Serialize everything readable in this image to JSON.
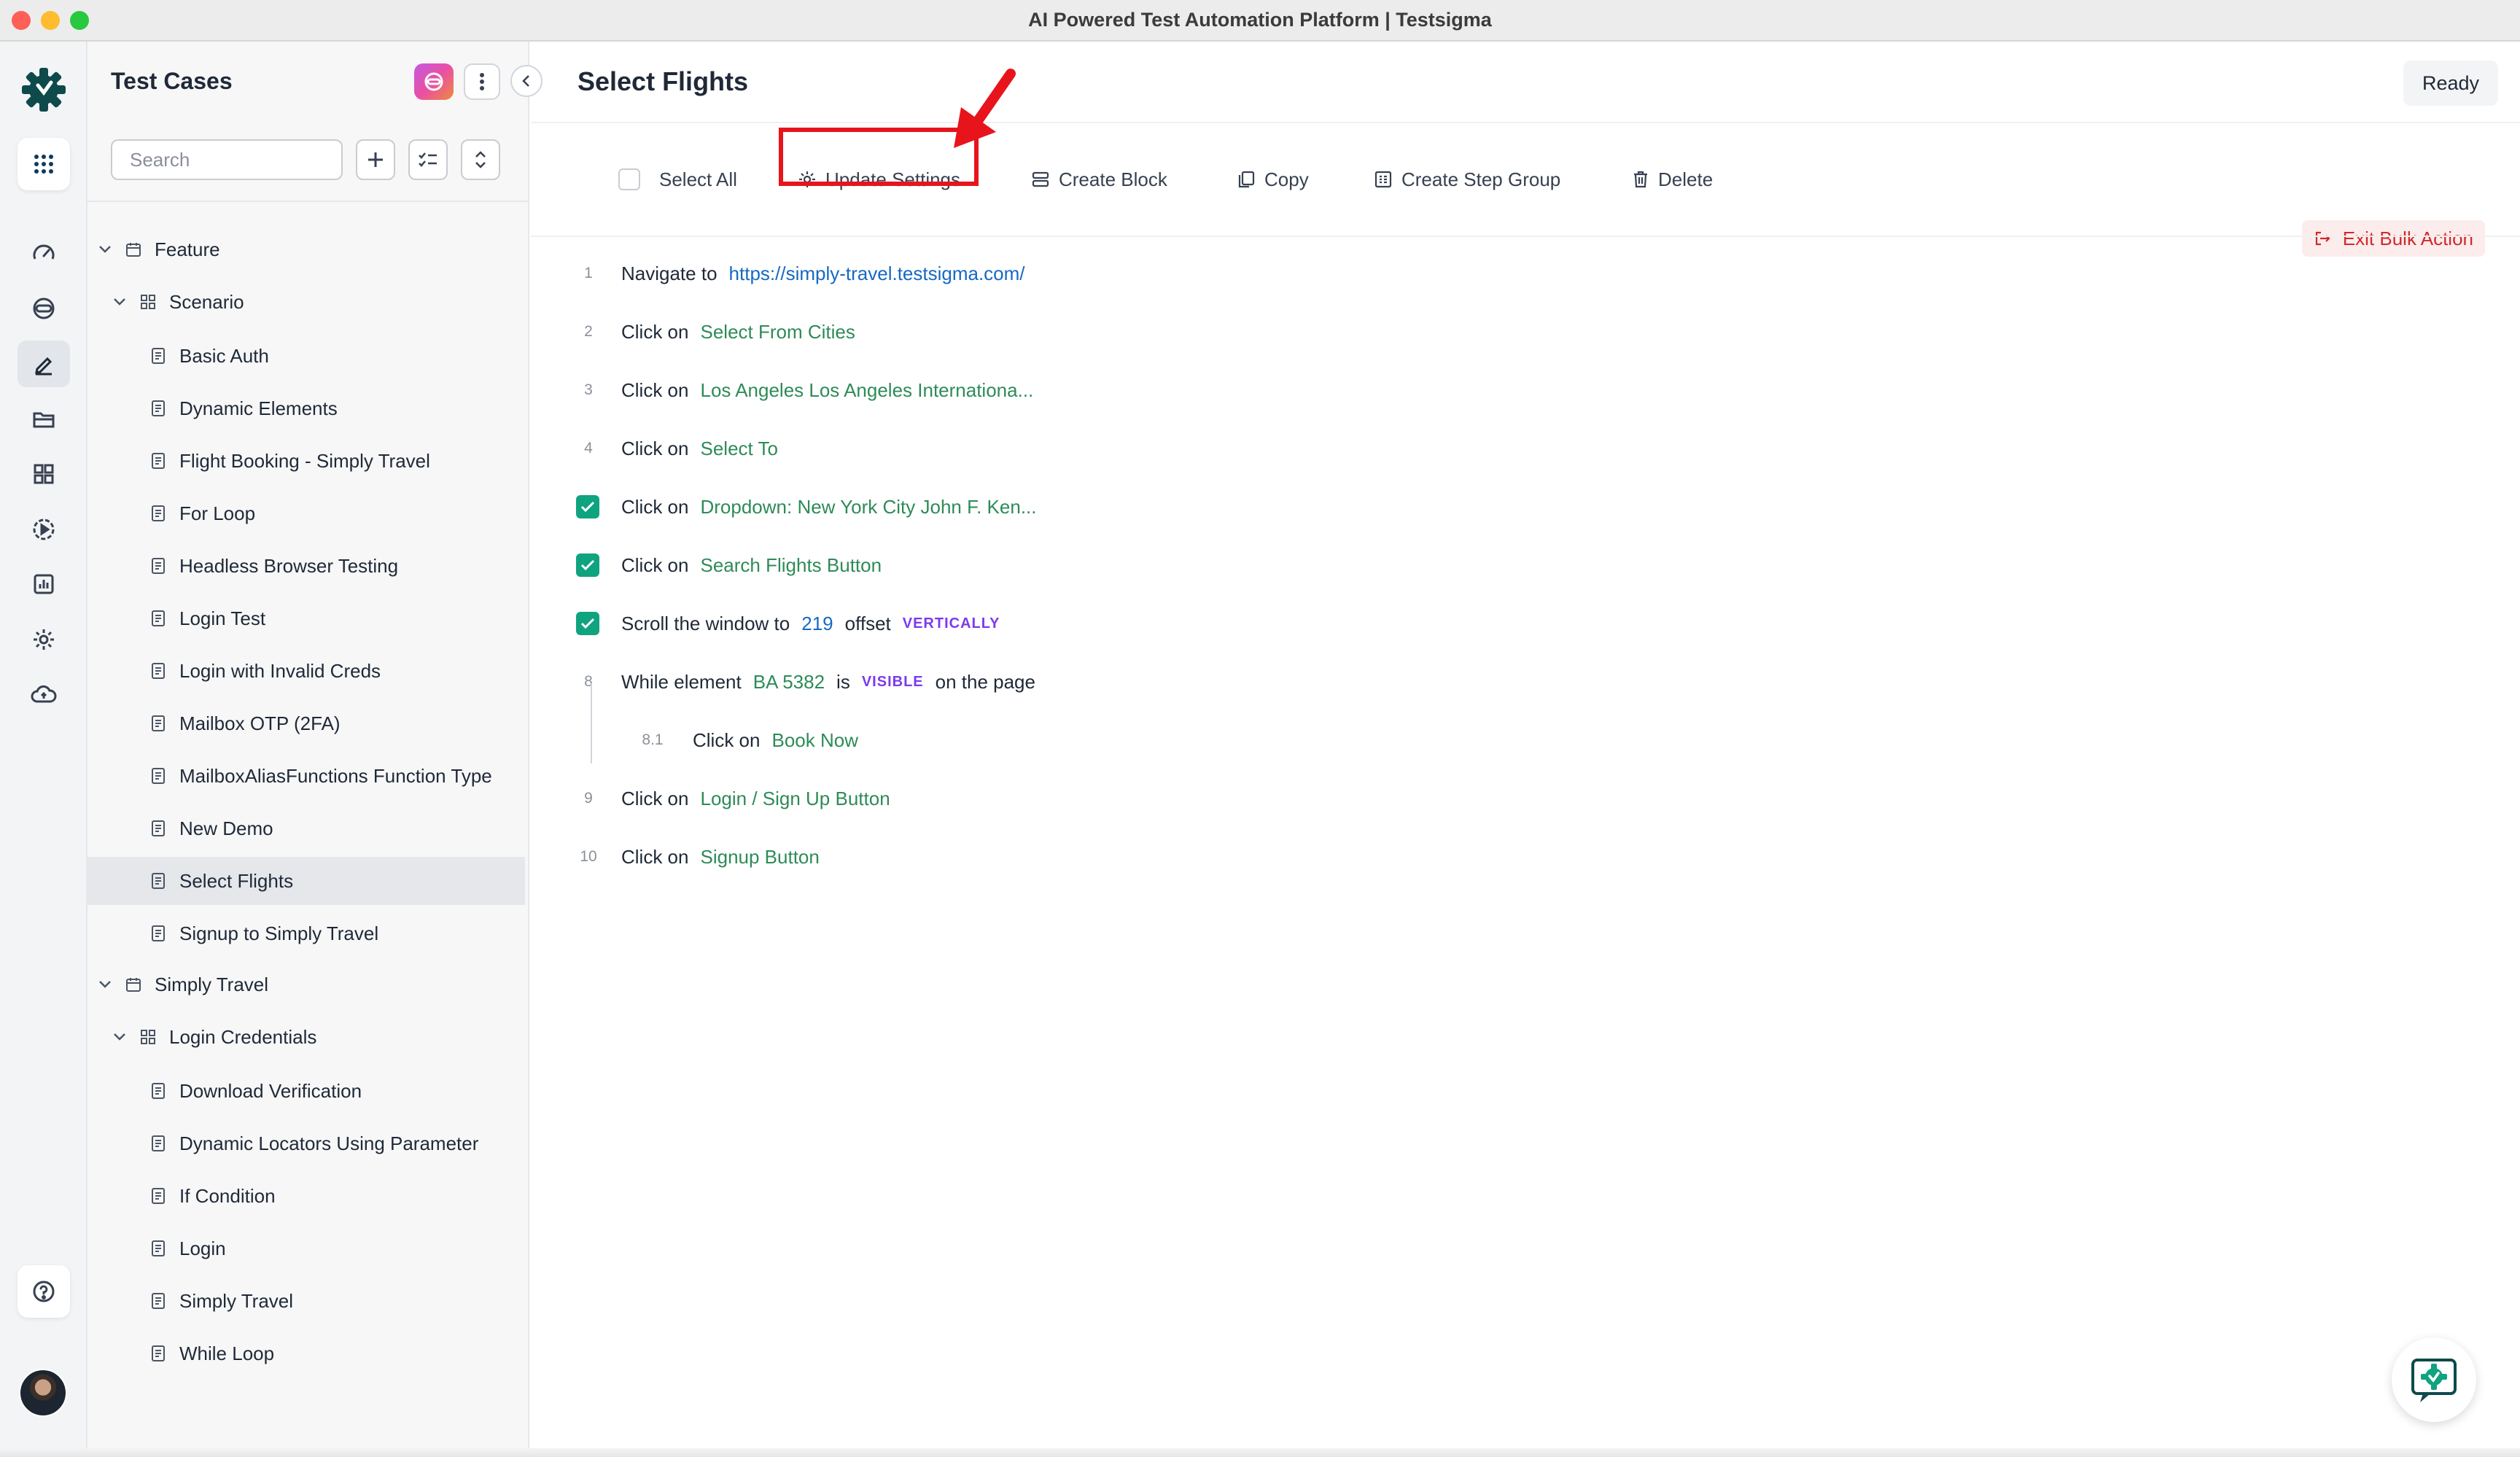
{
  "window": {
    "title": "AI Powered Test Automation Platform | Testsigma"
  },
  "rail": {
    "icons": [
      "apps-icon",
      "dashboard-icon",
      "ai-agent-icon",
      "edit-icon",
      "folder-icon",
      "widgets-icon",
      "run-icon",
      "reports-icon",
      "settings-icon",
      "cloud-icon"
    ],
    "active": "edit-icon"
  },
  "panel": {
    "title": "Test Cases",
    "search_placeholder": "Search",
    "tree": [
      {
        "label": "Feature",
        "type": "feature",
        "level": 0
      },
      {
        "label": "Scenario",
        "type": "scenario",
        "level": 1
      },
      {
        "label": "Basic Auth",
        "type": "case",
        "level": 2
      },
      {
        "label": "Dynamic Elements",
        "type": "case",
        "level": 2
      },
      {
        "label": "Flight Booking - Simply Travel",
        "type": "case",
        "level": 2
      },
      {
        "label": "For Loop",
        "type": "case",
        "level": 2
      },
      {
        "label": "Headless Browser Testing",
        "type": "case",
        "level": 2
      },
      {
        "label": "Login Test",
        "type": "case",
        "level": 2
      },
      {
        "label": "Login with Invalid Creds",
        "type": "case",
        "level": 2
      },
      {
        "label": "Mailbox OTP (2FA)",
        "type": "case",
        "level": 2
      },
      {
        "label": "MailboxAliasFunctions Function Type",
        "type": "case",
        "level": 2
      },
      {
        "label": "New Demo",
        "type": "case",
        "level": 2
      },
      {
        "label": "Select Flights",
        "type": "case",
        "level": 2,
        "selected": true
      },
      {
        "label": "Signup to Simply Travel",
        "type": "case",
        "level": 2
      },
      {
        "label": "Simply Travel",
        "type": "feature",
        "level": 0
      },
      {
        "label": "Login Credentials",
        "type": "scenario",
        "level": 1
      },
      {
        "label": "Download Verification",
        "type": "case",
        "level": 2
      },
      {
        "label": "Dynamic Locators Using Parameter",
        "type": "case",
        "level": 2
      },
      {
        "label": "If Condition",
        "type": "case",
        "level": 2
      },
      {
        "label": "Login",
        "type": "case",
        "level": 2
      },
      {
        "label": "Simply Travel",
        "type": "case",
        "level": 2
      },
      {
        "label": "While Loop",
        "type": "case",
        "level": 2
      }
    ]
  },
  "main": {
    "title": "Select Flights",
    "status": "Ready",
    "toolbar": {
      "select_all": "Select All",
      "update_settings": "Update Settings",
      "create_block": "Create Block",
      "copy": "Copy",
      "create_step_group": "Create Step Group",
      "delete": "Delete",
      "exit_bulk": "Exit Bulk Action"
    },
    "steps": [
      {
        "num": "1",
        "checked": false,
        "parts": [
          {
            "t": "text",
            "v": "Navigate to"
          },
          {
            "t": "link",
            "v": "https://simply-travel.testsigma.com/"
          }
        ]
      },
      {
        "num": "2",
        "checked": false,
        "parts": [
          {
            "t": "text",
            "v": "Click on"
          },
          {
            "t": "elem",
            "v": "Select From Cities"
          }
        ]
      },
      {
        "num": "3",
        "checked": false,
        "parts": [
          {
            "t": "text",
            "v": "Click on"
          },
          {
            "t": "elem",
            "v": "Los Angeles Los Angeles Internationa..."
          }
        ]
      },
      {
        "num": "4",
        "checked": false,
        "parts": [
          {
            "t": "text",
            "v": "Click on"
          },
          {
            "t": "elem",
            "v": "Select To"
          }
        ]
      },
      {
        "num": "5",
        "checked": true,
        "parts": [
          {
            "t": "text",
            "v": "Click on"
          },
          {
            "t": "elem",
            "v": "Dropdown: New York City John F. Ken..."
          }
        ]
      },
      {
        "num": "6",
        "checked": true,
        "parts": [
          {
            "t": "text",
            "v": "Click on"
          },
          {
            "t": "elem",
            "v": "Search Flights Button"
          }
        ]
      },
      {
        "num": "7",
        "checked": true,
        "parts": [
          {
            "t": "text",
            "v": "Scroll the window to"
          },
          {
            "t": "link",
            "v": "219"
          },
          {
            "t": "text",
            "v": "offset"
          },
          {
            "t": "kw",
            "v": "VERTICALLY"
          }
        ]
      },
      {
        "num": "8",
        "checked": false,
        "parts": [
          {
            "t": "text",
            "v": "While element"
          },
          {
            "t": "elem",
            "v": "BA 5382"
          },
          {
            "t": "text",
            "v": "is"
          },
          {
            "t": "kw",
            "v": "VISIBLE"
          },
          {
            "t": "text",
            "v": "on the page"
          }
        ]
      },
      {
        "num": "8.1",
        "checked": false,
        "sub": true,
        "parts": [
          {
            "t": "text",
            "v": "Click on"
          },
          {
            "t": "elem",
            "v": "Book Now"
          }
        ]
      },
      {
        "num": "9",
        "checked": false,
        "parts": [
          {
            "t": "text",
            "v": "Click on"
          },
          {
            "t": "elem",
            "v": "Login / Sign Up Button"
          }
        ]
      },
      {
        "num": "10",
        "checked": false,
        "parts": [
          {
            "t": "text",
            "v": "Click on"
          },
          {
            "t": "elem",
            "v": "Signup Button"
          }
        ]
      }
    ]
  },
  "colors": {
    "accent_green": "#10a37f",
    "link_blue": "#1769c2",
    "element_green": "#2e8b57",
    "keyword_purple": "#7c3aed",
    "annotation_red": "#e8141c"
  }
}
